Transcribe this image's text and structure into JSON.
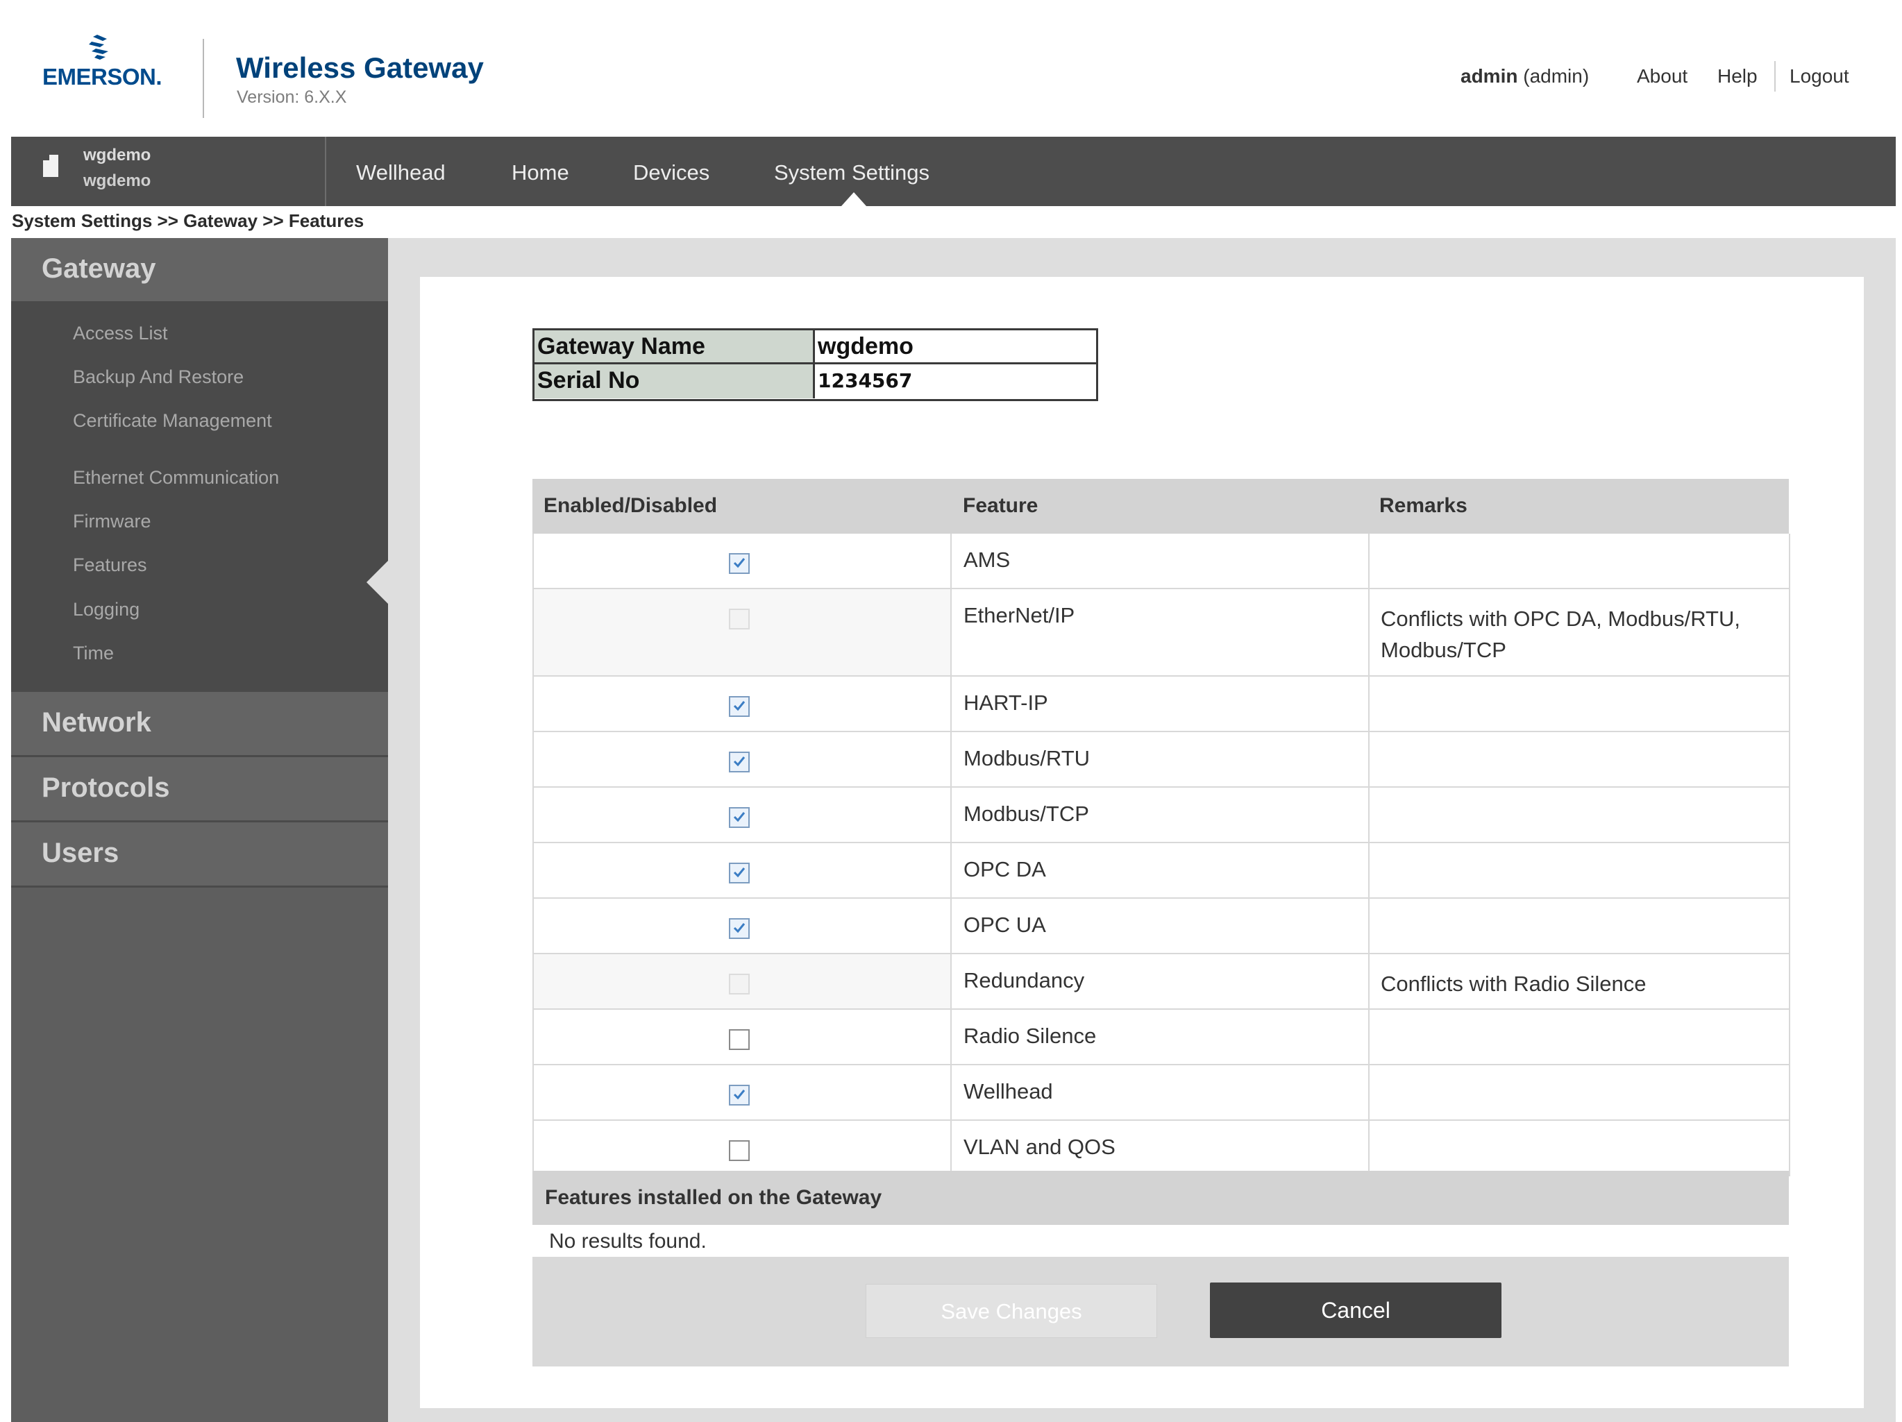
{
  "header": {
    "logo_text": "EMERSON.",
    "app_title": "Wireless Gateway",
    "app_version": "Version: 6.X.X",
    "user_name": "admin",
    "user_role": "(admin)",
    "links": {
      "about": "About",
      "help": "Help",
      "logout": "Logout"
    }
  },
  "site": {
    "name": "wgdemo",
    "sub": "wgdemo",
    "icon": "building-icon"
  },
  "nav": {
    "items": [
      "Wellhead",
      "Home",
      "Devices",
      "System Settings"
    ],
    "active": "System Settings"
  },
  "breadcrumb": "System Settings >> Gateway >> Features",
  "sidebar": {
    "gateway": "Gateway",
    "gateway_items": [
      "Access List",
      "Backup And Restore",
      "Certificate Management",
      "Ethernet Communication",
      "Firmware",
      "Features",
      "Logging",
      "Time"
    ],
    "active_item": "Features",
    "network": "Network",
    "protocols": "Protocols",
    "users": "Users"
  },
  "gateway_info": {
    "name_label": "Gateway Name",
    "name_value": "wgdemo",
    "serial_label": "Serial No",
    "serial_value": "1234567"
  },
  "feature_table": {
    "columns": [
      "Enabled/Disabled",
      "Feature",
      "Remarks"
    ],
    "rows": [
      {
        "enabled": true,
        "disabled_control": false,
        "feature": "AMS",
        "remarks": ""
      },
      {
        "enabled": false,
        "disabled_control": true,
        "feature": "EtherNet/IP",
        "remarks": "Conflicts with OPC DA, Modbus/RTU, Modbus/TCP"
      },
      {
        "enabled": true,
        "disabled_control": false,
        "feature": "HART-IP",
        "remarks": ""
      },
      {
        "enabled": true,
        "disabled_control": false,
        "feature": "Modbus/RTU",
        "remarks": ""
      },
      {
        "enabled": true,
        "disabled_control": false,
        "feature": "Modbus/TCP",
        "remarks": ""
      },
      {
        "enabled": true,
        "disabled_control": false,
        "feature": "OPC DA",
        "remarks": ""
      },
      {
        "enabled": true,
        "disabled_control": false,
        "feature": "OPC UA",
        "remarks": ""
      },
      {
        "enabled": false,
        "disabled_control": true,
        "feature": "Redundancy",
        "remarks": "Conflicts with Radio Silence"
      },
      {
        "enabled": false,
        "disabled_control": false,
        "feature": "Radio Silence",
        "remarks": ""
      },
      {
        "enabled": true,
        "disabled_control": false,
        "feature": "Wellhead",
        "remarks": ""
      },
      {
        "enabled": false,
        "disabled_control": false,
        "feature": "VLAN and QOS",
        "remarks": ""
      }
    ]
  },
  "installed": {
    "header": "Features installed on the Gateway",
    "empty_text": "No results found."
  },
  "buttons": {
    "save": "Save Changes",
    "cancel": "Cancel"
  },
  "colors": {
    "brand_blue": "#00427a",
    "nav_bg": "#4d4d4d",
    "sidebar_bg": "#5e5e5e",
    "checked_blue": "#3b7dc4"
  }
}
